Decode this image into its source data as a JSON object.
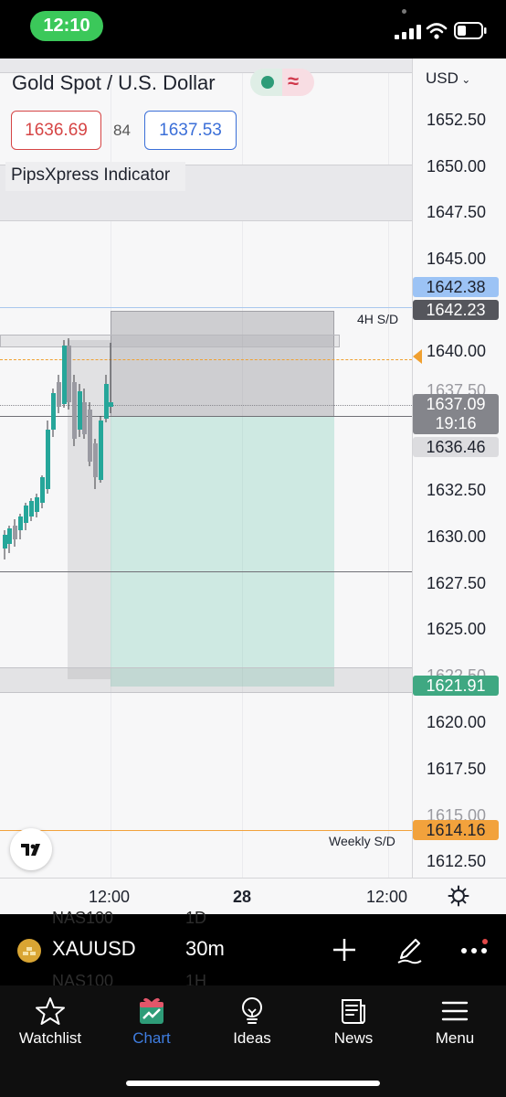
{
  "status_bar": {
    "time": "12:10"
  },
  "chart": {
    "instrument_title": "Gold Spot / U.S. Dollar",
    "bid": "1636.69",
    "spread": "84",
    "ask": "1637.53",
    "indicator": "PipsXpress Indicator",
    "currency": "USD",
    "price_levels": [
      "1652.50",
      "1650.00",
      "1647.50",
      "1645.00",
      "1640.00",
      "1637.50",
      "1632.50",
      "1630.00",
      "1627.50",
      "1625.00",
      "1622.50",
      "1620.00",
      "1617.50",
      "1615.00",
      "1612.50"
    ],
    "tags": {
      "tag_1642_38": "1642.38",
      "tag_1642_23": "1642.23",
      "last_price": "1637.09",
      "countdown": "19:16",
      "tag_1636_46": "1636.46",
      "tag_1621_91": "1621.91",
      "tag_1614_16": "1614.16"
    },
    "zone_labels": {
      "h4": "4H S/D",
      "weekly": "Weekly S/D"
    },
    "time_labels": [
      "12:00",
      "28",
      "12:00"
    ],
    "colors": {
      "up": "#26a69a",
      "down": "#9a9aa2",
      "bid": "#d64545",
      "ask": "#3b6fd8",
      "orange": "#f0a030",
      "blue_line": "#7fb0ea",
      "tag_blue": "#9cc3f5",
      "tag_dark": "#55565c",
      "tag_green": "#3fa882",
      "tag_orange": "#f2a23c"
    }
  },
  "symbol_bar": {
    "symbol": "XAUUSD",
    "interval": "30m",
    "ghost_rows": [
      {
        "symbol": "NAS100",
        "interval": "1D"
      },
      {
        "symbol": "NAS100",
        "interval": "1H"
      }
    ],
    "icons": [
      "plus-icon",
      "pen-icon",
      "more-icon"
    ]
  },
  "nav": {
    "items": [
      {
        "label": "Watchlist",
        "icon": "star-icon"
      },
      {
        "label": "Chart",
        "icon": "chart-gift-icon",
        "active": true
      },
      {
        "label": "Ideas",
        "icon": "lightbulb-icon"
      },
      {
        "label": "News",
        "icon": "news-icon"
      },
      {
        "label": "Menu",
        "icon": "menu-icon"
      }
    ]
  }
}
